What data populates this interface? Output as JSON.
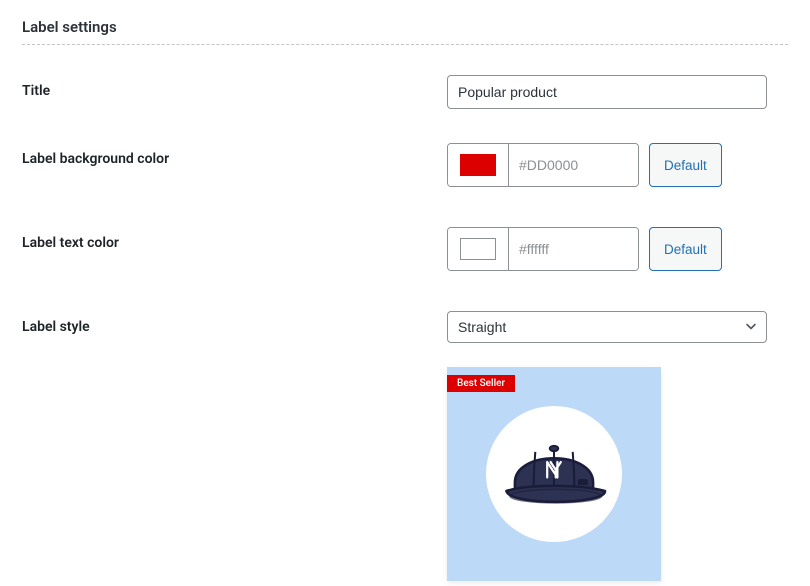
{
  "section": {
    "heading": "Label settings"
  },
  "form": {
    "title": {
      "label": "Title",
      "value": "Popular product"
    },
    "bgColor": {
      "label": "Label background color",
      "swatch": "#DD0000",
      "placeholder": "#DD0000",
      "defaultBtn": "Default"
    },
    "textColor": {
      "label": "Label text color",
      "swatch": "#ffffff",
      "placeholder": "#ffffff",
      "defaultBtn": "Default"
    },
    "style": {
      "label": "Label style",
      "value": "Straight"
    }
  },
  "preview": {
    "badge": "Best Seller"
  }
}
